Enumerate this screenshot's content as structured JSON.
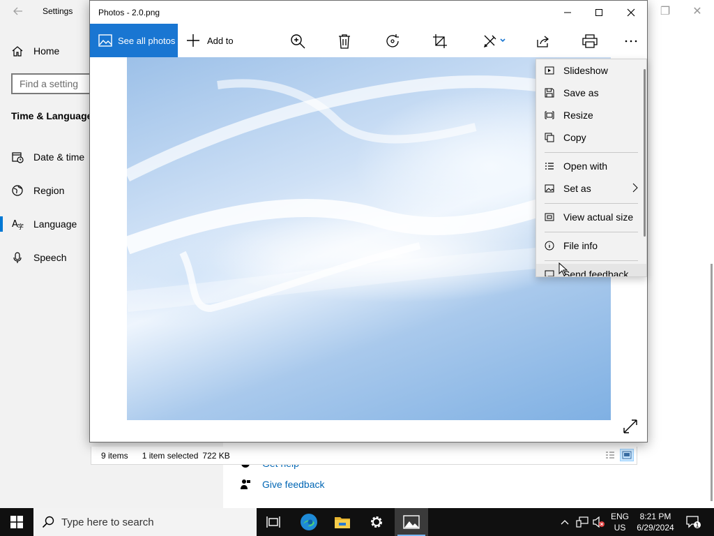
{
  "settings": {
    "title": "Settings",
    "home_label": "Home",
    "search_placeholder": "Find a setting",
    "section_title": "Time & Language",
    "nav": [
      {
        "label": "Date & time"
      },
      {
        "label": "Region"
      },
      {
        "label": "Language"
      },
      {
        "label": "Speech"
      }
    ],
    "help_links": [
      {
        "label": "Get help"
      },
      {
        "label": "Give feedback"
      }
    ],
    "accent": "#0078d4"
  },
  "photos": {
    "title": "Photos - 2.0.png",
    "toolbar": {
      "see_all_label": "See all photos",
      "add_to_label": "Add to"
    },
    "accent": "#1976d2"
  },
  "context_menu": {
    "items": [
      {
        "label": "Slideshow",
        "icon": "slideshow-icon"
      },
      {
        "label": "Save as",
        "icon": "save-icon"
      },
      {
        "label": "Resize",
        "icon": "resize-icon"
      },
      {
        "label": "Copy",
        "icon": "copy-icon"
      },
      {
        "label": "Open with",
        "icon": "open-with-icon"
      },
      {
        "label": "Set as",
        "icon": "set-as-icon"
      },
      {
        "label": "View actual size",
        "icon": "actual-size-icon"
      },
      {
        "label": "File info",
        "icon": "info-icon"
      },
      {
        "label": "Send feedback",
        "icon": "feedback-icon"
      }
    ]
  },
  "explorer_status": {
    "item_count": "9 items",
    "selection": "1 item selected",
    "size": "722 KB"
  },
  "taskbar": {
    "search_placeholder": "Type here to search",
    "language_top": "ENG",
    "language_bottom": "US",
    "time": "8:21 PM",
    "date": "6/29/2024",
    "notification_count": "1"
  }
}
